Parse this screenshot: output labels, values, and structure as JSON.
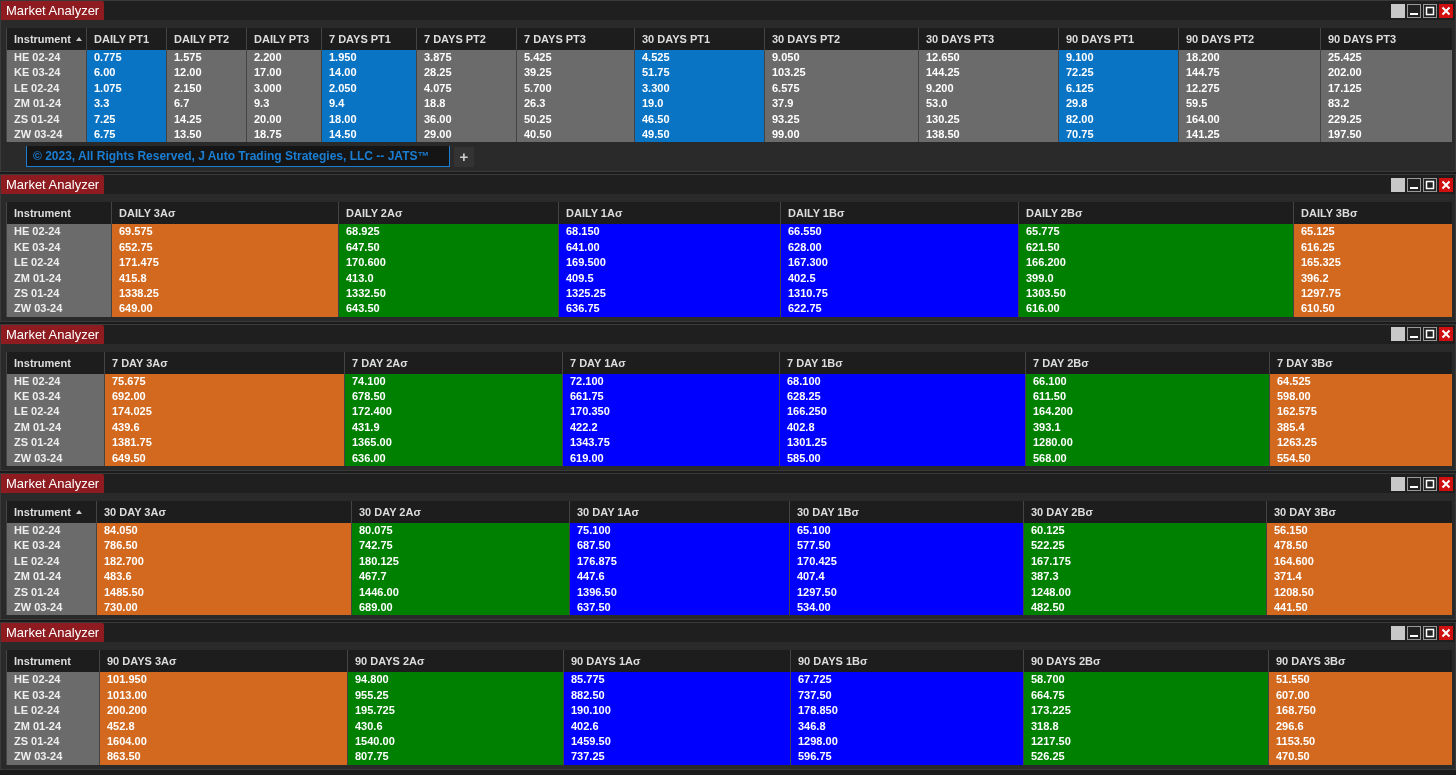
{
  "windows": [
    {
      "title": "Market Analyzer",
      "instrument_header": {
        "label": "Instrument",
        "sorted": true
      },
      "columns": [
        {
          "label": "DAILY PT1",
          "color": "#0a74c4"
        },
        {
          "label": "DAILY PT2",
          "color": "#6b6b6b"
        },
        {
          "label": "DAILY PT3",
          "color": "#6b6b6b"
        },
        {
          "label": "7 DAYS PT1",
          "color": "#0a74c4"
        },
        {
          "label": "7 DAYS PT2",
          "color": "#6b6b6b"
        },
        {
          "label": "7 DAYS PT3",
          "color": "#6b6b6b"
        },
        {
          "label": "30 DAYS PT1",
          "color": "#0a74c4"
        },
        {
          "label": "30 DAYS PT2",
          "color": "#6b6b6b"
        },
        {
          "label": "30 DAYS PT3",
          "color": "#6b6b6b"
        },
        {
          "label": "90 DAYS PT1",
          "color": "#0a74c4"
        },
        {
          "label": "90 DAYS PT2",
          "color": "#6b6b6b"
        },
        {
          "label": "90 DAYS PT3",
          "color": "#6b6b6b"
        }
      ],
      "rows": [
        {
          "instrument": "HE 02-24",
          "values": [
            "0.775",
            "1.575",
            "2.200",
            "1.950",
            "3.875",
            "5.425",
            "4.525",
            "9.050",
            "12.650",
            "9.100",
            "18.200",
            "25.425"
          ]
        },
        {
          "instrument": "KE 03-24",
          "values": [
            "6.00",
            "12.00",
            "17.00",
            "14.00",
            "28.25",
            "39.25",
            "51.75",
            "103.25",
            "144.25",
            "72.25",
            "144.75",
            "202.00"
          ]
        },
        {
          "instrument": "LE 02-24",
          "values": [
            "1.075",
            "2.150",
            "3.000",
            "2.050",
            "4.075",
            "5.700",
            "3.300",
            "6.575",
            "9.200",
            "6.125",
            "12.275",
            "17.125"
          ]
        },
        {
          "instrument": "ZM 01-24",
          "values": [
            "3.3",
            "6.7",
            "9.3",
            "9.4",
            "18.8",
            "26.3",
            "19.0",
            "37.9",
            "53.0",
            "29.8",
            "59.5",
            "83.2"
          ]
        },
        {
          "instrument": "ZS 01-24",
          "values": [
            "7.25",
            "14.25",
            "20.00",
            "18.00",
            "36.00",
            "50.25",
            "46.50",
            "93.25",
            "130.25",
            "82.00",
            "164.00",
            "229.25"
          ]
        },
        {
          "instrument": "ZW 03-24",
          "values": [
            "6.75",
            "13.50",
            "18.75",
            "14.50",
            "29.00",
            "40.50",
            "49.50",
            "99.00",
            "138.50",
            "70.75",
            "141.25",
            "197.50"
          ]
        }
      ],
      "footer": {
        "tab": "© 2023, All Rights Reserved, J Auto Trading Strategies, LLC -- JATS™",
        "add_button": "+"
      }
    },
    {
      "title": "Market Analyzer",
      "instrument_header": {
        "label": "Instrument"
      },
      "columns": [
        {
          "label": "DAILY 3Aσ",
          "color": "#d2691e"
        },
        {
          "label": "DAILY 2Aσ",
          "color": "#008000"
        },
        {
          "label": "DAILY 1Aσ",
          "color": "#0000ff"
        },
        {
          "label": "DAILY 1Bσ",
          "color": "#0000ff"
        },
        {
          "label": "DAILY 2Bσ",
          "color": "#008000"
        },
        {
          "label": "DAILY 3Bσ",
          "color": "#d2691e"
        }
      ],
      "rows": [
        {
          "instrument": "HE 02-24",
          "values": [
            "69.575",
            "68.925",
            "68.150",
            "66.550",
            "65.775",
            "65.125"
          ]
        },
        {
          "instrument": "KE 03-24",
          "values": [
            "652.75",
            "647.50",
            "641.00",
            "628.00",
            "621.50",
            "616.25"
          ]
        },
        {
          "instrument": "LE 02-24",
          "values": [
            "171.475",
            "170.600",
            "169.500",
            "167.300",
            "166.200",
            "165.325"
          ]
        },
        {
          "instrument": "ZM 01-24",
          "values": [
            "415.8",
            "413.0",
            "409.5",
            "402.5",
            "399.0",
            "396.2"
          ]
        },
        {
          "instrument": "ZS 01-24",
          "values": [
            "1338.25",
            "1332.50",
            "1325.25",
            "1310.75",
            "1303.50",
            "1297.75"
          ]
        },
        {
          "instrument": "ZW 03-24",
          "values": [
            "649.00",
            "643.50",
            "636.75",
            "622.75",
            "616.00",
            "610.50"
          ]
        }
      ]
    },
    {
      "title": "Market Analyzer",
      "instrument_header": {
        "label": "Instrument"
      },
      "columns": [
        {
          "label": "7 DAY 3Aσ",
          "color": "#d2691e"
        },
        {
          "label": "7 DAY 2Aσ",
          "color": "#008000"
        },
        {
          "label": "7 DAY 1Aσ",
          "color": "#0000ff"
        },
        {
          "label": "7 DAY 1Bσ",
          "color": "#0000ff"
        },
        {
          "label": "7 DAY 2Bσ",
          "color": "#008000"
        },
        {
          "label": "7 DAY 3Bσ",
          "color": "#d2691e"
        }
      ],
      "rows": [
        {
          "instrument": "HE 02-24",
          "values": [
            "75.675",
            "74.100",
            "72.100",
            "68.100",
            "66.100",
            "64.525"
          ]
        },
        {
          "instrument": "KE 03-24",
          "values": [
            "692.00",
            "678.50",
            "661.75",
            "628.25",
            "611.50",
            "598.00"
          ]
        },
        {
          "instrument": "LE 02-24",
          "values": [
            "174.025",
            "172.400",
            "170.350",
            "166.250",
            "164.200",
            "162.575"
          ]
        },
        {
          "instrument": "ZM 01-24",
          "values": [
            "439.6",
            "431.9",
            "422.2",
            "402.8",
            "393.1",
            "385.4"
          ]
        },
        {
          "instrument": "ZS 01-24",
          "values": [
            "1381.75",
            "1365.00",
            "1343.75",
            "1301.25",
            "1280.00",
            "1263.25"
          ]
        },
        {
          "instrument": "ZW 03-24",
          "values": [
            "649.50",
            "636.00",
            "619.00",
            "585.00",
            "568.00",
            "554.50"
          ]
        }
      ]
    },
    {
      "title": "Market Analyzer",
      "instrument_header": {
        "label": "Instrument",
        "sorted": true
      },
      "columns": [
        {
          "label": "30 DAY 3Aσ",
          "color": "#d2691e"
        },
        {
          "label": "30 DAY 2Aσ",
          "color": "#008000"
        },
        {
          "label": "30 DAY 1Aσ",
          "color": "#0000ff"
        },
        {
          "label": "30 DAY 1Bσ",
          "color": "#0000ff"
        },
        {
          "label": "30 DAY 2Bσ",
          "color": "#008000"
        },
        {
          "label": "30 DAY 3Bσ",
          "color": "#d2691e"
        }
      ],
      "rows": [
        {
          "instrument": "HE 02-24",
          "values": [
            "84.050",
            "80.075",
            "75.100",
            "65.100",
            "60.125",
            "56.150"
          ]
        },
        {
          "instrument": "KE 03-24",
          "values": [
            "786.50",
            "742.75",
            "687.50",
            "577.50",
            "522.25",
            "478.50"
          ]
        },
        {
          "instrument": "LE 02-24",
          "values": [
            "182.700",
            "180.125",
            "176.875",
            "170.425",
            "167.175",
            "164.600"
          ]
        },
        {
          "instrument": "ZM 01-24",
          "values": [
            "483.6",
            "467.7",
            "447.6",
            "407.4",
            "387.3",
            "371.4"
          ]
        },
        {
          "instrument": "ZS 01-24",
          "values": [
            "1485.50",
            "1446.00",
            "1396.50",
            "1297.50",
            "1248.00",
            "1208.50"
          ]
        },
        {
          "instrument": "ZW 03-24",
          "values": [
            "730.00",
            "689.00",
            "637.50",
            "534.00",
            "482.50",
            "441.50"
          ]
        }
      ]
    },
    {
      "title": "Market Analyzer",
      "instrument_header": {
        "label": "Instrument"
      },
      "columns": [
        {
          "label": "90 DAYS 3Aσ",
          "color": "#d2691e"
        },
        {
          "label": "90 DAYS 2Aσ",
          "color": "#008000"
        },
        {
          "label": "90 DAYS 1Aσ",
          "color": "#0000ff"
        },
        {
          "label": "90 DAYS 1Bσ",
          "color": "#0000ff"
        },
        {
          "label": "90 DAYS 2Bσ",
          "color": "#008000"
        },
        {
          "label": "90 DAYS 3Bσ",
          "color": "#d2691e"
        }
      ],
      "rows": [
        {
          "instrument": "HE 02-24",
          "values": [
            "101.950",
            "94.800",
            "85.775",
            "67.725",
            "58.700",
            "51.550"
          ]
        },
        {
          "instrument": "KE 03-24",
          "values": [
            "1013.00",
            "955.25",
            "882.50",
            "737.50",
            "664.75",
            "607.00"
          ]
        },
        {
          "instrument": "LE 02-24",
          "values": [
            "200.200",
            "195.725",
            "190.100",
            "178.850",
            "173.225",
            "168.750"
          ]
        },
        {
          "instrument": "ZM 01-24",
          "values": [
            "452.8",
            "430.6",
            "402.6",
            "346.8",
            "318.8",
            "296.6"
          ]
        },
        {
          "instrument": "ZS 01-24",
          "values": [
            "1604.00",
            "1540.00",
            "1459.50",
            "1298.00",
            "1217.50",
            "1153.50"
          ]
        },
        {
          "instrument": "ZW 03-24",
          "values": [
            "863.50",
            "807.75",
            "737.25",
            "596.75",
            "526.25",
            "470.50"
          ]
        }
      ]
    }
  ]
}
